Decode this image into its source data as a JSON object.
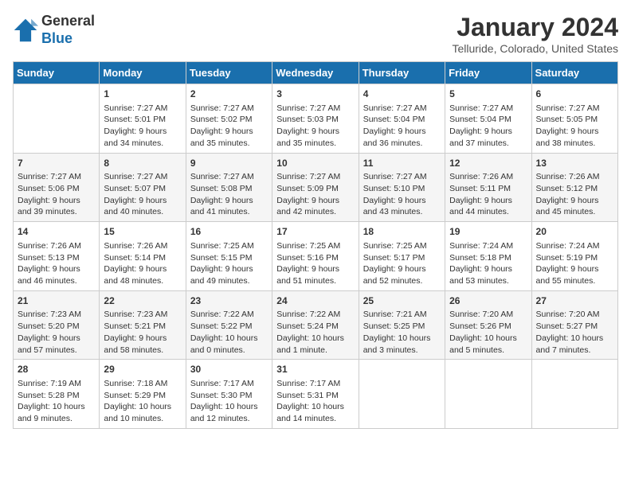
{
  "header": {
    "logo_general": "General",
    "logo_blue": "Blue",
    "month_title": "January 2024",
    "location": "Telluride, Colorado, United States"
  },
  "days_of_week": [
    "Sunday",
    "Monday",
    "Tuesday",
    "Wednesday",
    "Thursday",
    "Friday",
    "Saturday"
  ],
  "weeks": [
    [
      {
        "day": "",
        "sunrise": "",
        "sunset": "",
        "daylight": ""
      },
      {
        "day": "1",
        "sunrise": "Sunrise: 7:27 AM",
        "sunset": "Sunset: 5:01 PM",
        "daylight": "Daylight: 9 hours and 34 minutes."
      },
      {
        "day": "2",
        "sunrise": "Sunrise: 7:27 AM",
        "sunset": "Sunset: 5:02 PM",
        "daylight": "Daylight: 9 hours and 35 minutes."
      },
      {
        "day": "3",
        "sunrise": "Sunrise: 7:27 AM",
        "sunset": "Sunset: 5:03 PM",
        "daylight": "Daylight: 9 hours and 35 minutes."
      },
      {
        "day": "4",
        "sunrise": "Sunrise: 7:27 AM",
        "sunset": "Sunset: 5:04 PM",
        "daylight": "Daylight: 9 hours and 36 minutes."
      },
      {
        "day": "5",
        "sunrise": "Sunrise: 7:27 AM",
        "sunset": "Sunset: 5:04 PM",
        "daylight": "Daylight: 9 hours and 37 minutes."
      },
      {
        "day": "6",
        "sunrise": "Sunrise: 7:27 AM",
        "sunset": "Sunset: 5:05 PM",
        "daylight": "Daylight: 9 hours and 38 minutes."
      }
    ],
    [
      {
        "day": "7",
        "sunrise": "Sunrise: 7:27 AM",
        "sunset": "Sunset: 5:06 PM",
        "daylight": "Daylight: 9 hours and 39 minutes."
      },
      {
        "day": "8",
        "sunrise": "Sunrise: 7:27 AM",
        "sunset": "Sunset: 5:07 PM",
        "daylight": "Daylight: 9 hours and 40 minutes."
      },
      {
        "day": "9",
        "sunrise": "Sunrise: 7:27 AM",
        "sunset": "Sunset: 5:08 PM",
        "daylight": "Daylight: 9 hours and 41 minutes."
      },
      {
        "day": "10",
        "sunrise": "Sunrise: 7:27 AM",
        "sunset": "Sunset: 5:09 PM",
        "daylight": "Daylight: 9 hours and 42 minutes."
      },
      {
        "day": "11",
        "sunrise": "Sunrise: 7:27 AM",
        "sunset": "Sunset: 5:10 PM",
        "daylight": "Daylight: 9 hours and 43 minutes."
      },
      {
        "day": "12",
        "sunrise": "Sunrise: 7:26 AM",
        "sunset": "Sunset: 5:11 PM",
        "daylight": "Daylight: 9 hours and 44 minutes."
      },
      {
        "day": "13",
        "sunrise": "Sunrise: 7:26 AM",
        "sunset": "Sunset: 5:12 PM",
        "daylight": "Daylight: 9 hours and 45 minutes."
      }
    ],
    [
      {
        "day": "14",
        "sunrise": "Sunrise: 7:26 AM",
        "sunset": "Sunset: 5:13 PM",
        "daylight": "Daylight: 9 hours and 46 minutes."
      },
      {
        "day": "15",
        "sunrise": "Sunrise: 7:26 AM",
        "sunset": "Sunset: 5:14 PM",
        "daylight": "Daylight: 9 hours and 48 minutes."
      },
      {
        "day": "16",
        "sunrise": "Sunrise: 7:25 AM",
        "sunset": "Sunset: 5:15 PM",
        "daylight": "Daylight: 9 hours and 49 minutes."
      },
      {
        "day": "17",
        "sunrise": "Sunrise: 7:25 AM",
        "sunset": "Sunset: 5:16 PM",
        "daylight": "Daylight: 9 hours and 51 minutes."
      },
      {
        "day": "18",
        "sunrise": "Sunrise: 7:25 AM",
        "sunset": "Sunset: 5:17 PM",
        "daylight": "Daylight: 9 hours and 52 minutes."
      },
      {
        "day": "19",
        "sunrise": "Sunrise: 7:24 AM",
        "sunset": "Sunset: 5:18 PM",
        "daylight": "Daylight: 9 hours and 53 minutes."
      },
      {
        "day": "20",
        "sunrise": "Sunrise: 7:24 AM",
        "sunset": "Sunset: 5:19 PM",
        "daylight": "Daylight: 9 hours and 55 minutes."
      }
    ],
    [
      {
        "day": "21",
        "sunrise": "Sunrise: 7:23 AM",
        "sunset": "Sunset: 5:20 PM",
        "daylight": "Daylight: 9 hours and 57 minutes."
      },
      {
        "day": "22",
        "sunrise": "Sunrise: 7:23 AM",
        "sunset": "Sunset: 5:21 PM",
        "daylight": "Daylight: 9 hours and 58 minutes."
      },
      {
        "day": "23",
        "sunrise": "Sunrise: 7:22 AM",
        "sunset": "Sunset: 5:22 PM",
        "daylight": "Daylight: 10 hours and 0 minutes."
      },
      {
        "day": "24",
        "sunrise": "Sunrise: 7:22 AM",
        "sunset": "Sunset: 5:24 PM",
        "daylight": "Daylight: 10 hours and 1 minute."
      },
      {
        "day": "25",
        "sunrise": "Sunrise: 7:21 AM",
        "sunset": "Sunset: 5:25 PM",
        "daylight": "Daylight: 10 hours and 3 minutes."
      },
      {
        "day": "26",
        "sunrise": "Sunrise: 7:20 AM",
        "sunset": "Sunset: 5:26 PM",
        "daylight": "Daylight: 10 hours and 5 minutes."
      },
      {
        "day": "27",
        "sunrise": "Sunrise: 7:20 AM",
        "sunset": "Sunset: 5:27 PM",
        "daylight": "Daylight: 10 hours and 7 minutes."
      }
    ],
    [
      {
        "day": "28",
        "sunrise": "Sunrise: 7:19 AM",
        "sunset": "Sunset: 5:28 PM",
        "daylight": "Daylight: 10 hours and 9 minutes."
      },
      {
        "day": "29",
        "sunrise": "Sunrise: 7:18 AM",
        "sunset": "Sunset: 5:29 PM",
        "daylight": "Daylight: 10 hours and 10 minutes."
      },
      {
        "day": "30",
        "sunrise": "Sunrise: 7:17 AM",
        "sunset": "Sunset: 5:30 PM",
        "daylight": "Daylight: 10 hours and 12 minutes."
      },
      {
        "day": "31",
        "sunrise": "Sunrise: 7:17 AM",
        "sunset": "Sunset: 5:31 PM",
        "daylight": "Daylight: 10 hours and 14 minutes."
      },
      {
        "day": "",
        "sunrise": "",
        "sunset": "",
        "daylight": ""
      },
      {
        "day": "",
        "sunrise": "",
        "sunset": "",
        "daylight": ""
      },
      {
        "day": "",
        "sunrise": "",
        "sunset": "",
        "daylight": ""
      }
    ]
  ]
}
